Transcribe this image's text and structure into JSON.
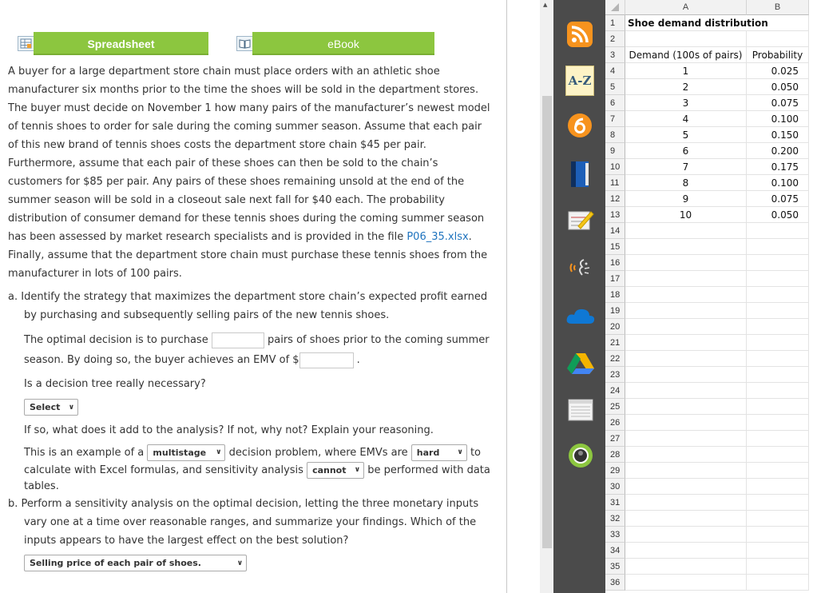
{
  "tabs": {
    "spreadsheet_label": "Spreadsheet",
    "ebook_label": "eBook"
  },
  "problem": {
    "lines": [
      "A buyer for a large department store chain must place orders with an athletic shoe",
      "manufacturer six months prior to the time the shoes will be sold in the department stores.",
      "The buyer must decide on November 1 how many pairs of the manufacturer’s newest model",
      "of tennis shoes to order for sale during the coming summer season. Assume that each pair",
      "of this new brand of tennis shoes costs the department store chain $45 per pair.",
      "Furthermore, assume that each pair of these shoes can then be sold to the chain’s",
      "customers for $85 per pair. Any pairs of these shoes remaining unsold at the end of the",
      "summer season will be sold in a closeout sale next fall for $40 each. The probability",
      "distribution of consumer demand for these tennis shoes during the coming summer season"
    ],
    "line10_before": "has been assessed by market research specialists and is provided in the file ",
    "file_link": "P06_35.xlsx",
    "line10_after": ".",
    "line11": "Finally, assume that the department store chain must purchase these tennis shoes from the",
    "line12": "manufacturer in lots of 100 pairs."
  },
  "part_a": {
    "question_line1": "a. Identify the strategy that maximizes the department store chain’s expected profit earned",
    "question_line2": "by purchasing and subsequently selling pairs of the new tennis shoes.",
    "optimal_before": "The optimal decision is to purchase",
    "optimal_after": "pairs of shoes prior to the coming summer",
    "emv_before": "season. By doing so, the buyer achieves an EMV of $",
    "emv_after": ".",
    "pairs_value": "",
    "emv_value": "",
    "tree_question": "Is a decision tree really necessary?",
    "tree_select": "Select",
    "explain_text": "If so, what does it add to the analysis? If not, why not? Explain your reasoning.",
    "ex_before": "This is an example of a",
    "ex_select1": "multistage",
    "ex_mid1": "decision problem, where EMVs are",
    "ex_select2": "hard",
    "ex_after": "to",
    "calc_before": "calculate with Excel formulas, and sensitivity analysis",
    "calc_select": "cannot",
    "calc_after": "be performed with data",
    "tables_text": "tables."
  },
  "part_b": {
    "line1": "b. Perform a sensitivity analysis on the optimal decision, letting the three monetary inputs",
    "line2": "vary one at a time over reasonable ranges, and summarize your findings. Which of the",
    "line3": "inputs appears to have the largest effect on the best solution?",
    "answer_select": "Selling price of each pair of shoes."
  },
  "dock": {
    "icons": [
      "rss-icon",
      "a-z-icon",
      "orange-six-icon",
      "book-icon",
      "notepad-pencil-icon",
      "read-aloud-icon",
      "cloud-icon",
      "drive-icon",
      "notes-icon",
      "avatar-ring-icon"
    ],
    "az_text": "A-Z",
    "colors": {
      "dock": "#4b4b4b",
      "rss": "#f7931e",
      "orange": "#f7931e",
      "cloud": "#0f78d4",
      "green": "#8cc63f"
    }
  },
  "spreadsheet": {
    "columns": [
      "A",
      "B"
    ],
    "rows": [
      "1",
      "2",
      "3",
      "4",
      "5",
      "6",
      "7",
      "8",
      "9",
      "10",
      "11",
      "12",
      "13",
      "14",
      "15",
      "16",
      "17",
      "18",
      "19",
      "20",
      "21",
      "22",
      "23",
      "24",
      "25",
      "26",
      "27",
      "28",
      "29",
      "30",
      "31",
      "32",
      "33",
      "34",
      "35",
      "36"
    ],
    "title": "Shoe demand distribution",
    "header_demand": "Demand (100s of pairs)",
    "header_probability": "Probability",
    "demand": [
      "1",
      "2",
      "3",
      "4",
      "5",
      "6",
      "7",
      "8",
      "9",
      "10"
    ],
    "probability": [
      "0.025",
      "0.050",
      "0.075",
      "0.100",
      "0.150",
      "0.200",
      "0.175",
      "0.100",
      "0.075",
      "0.050"
    ]
  }
}
